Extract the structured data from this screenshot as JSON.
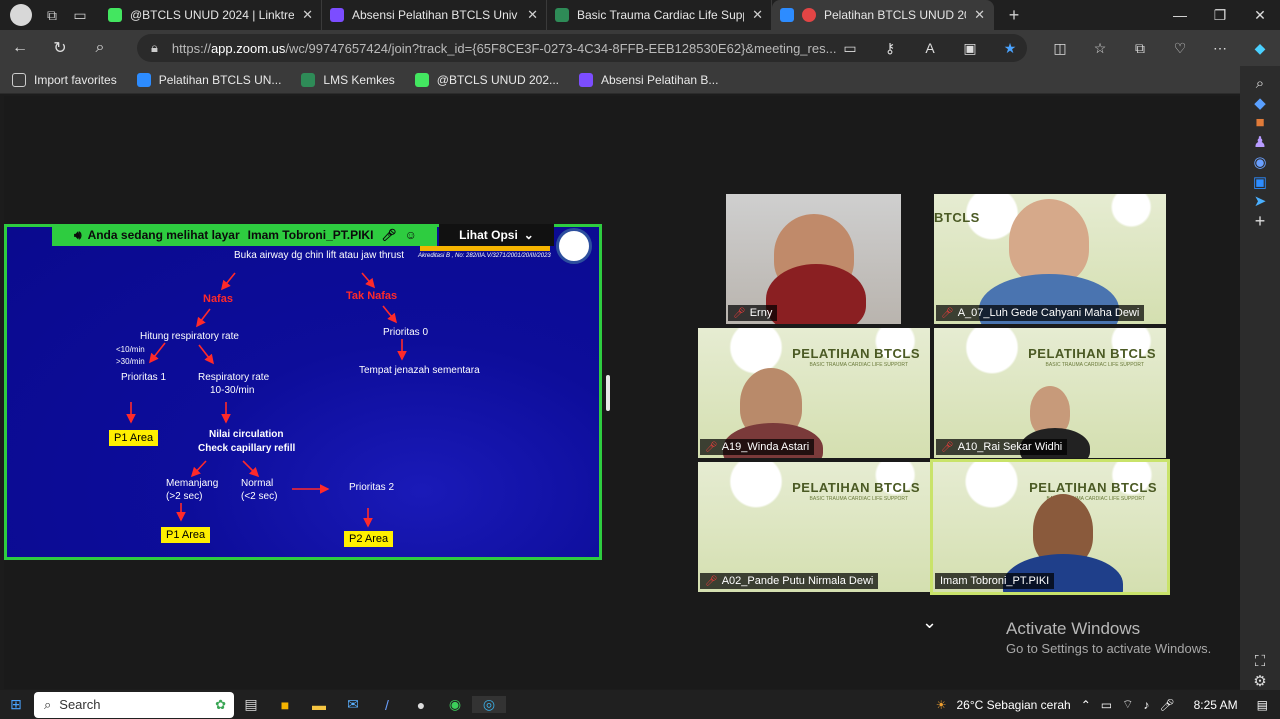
{
  "browser": {
    "tabs": [
      {
        "label": "@BTCLS UNUD 2024 | Linktree",
        "icon": "linktree-icon",
        "color": "#43e660"
      },
      {
        "label": "Absensi Pelatihan BTCLS Univ Ud",
        "icon": "form-icon",
        "color": "#7c4dff"
      },
      {
        "label": "Basic Trauma Cardiac Life Suppor",
        "icon": "lms-icon",
        "color": "#2e8b57"
      },
      {
        "label": "Pelatihan BTCLS UNUD 2024",
        "icon": "zoom-icon",
        "color": "#2d8cff",
        "active": true
      }
    ],
    "url_prefix": "https://",
    "url_host": "app.zoom.us",
    "url_rest": "/wc/99747657424/join?track_id={65F8CE3F-0273-4C34-8FFB-EEB128530E62}&meeting_res...",
    "bookmarks": [
      {
        "label": "Import favorites",
        "icon": "import-icon"
      },
      {
        "label": "Pelatihan BTCLS UN...",
        "icon": "zoom-icon"
      },
      {
        "label": "LMS Kemkes",
        "icon": "lms-icon"
      },
      {
        "label": "@BTCLS UNUD 202...",
        "icon": "linktree-icon"
      },
      {
        "label": "Absensi Pelatihan B...",
        "icon": "form-icon"
      }
    ]
  },
  "share": {
    "banner_prefix": "Anda sedang melihat layar",
    "presenter": "Imam Tobroni_PT.PIKI",
    "options_label": "Lihat Opsi",
    "accreditation": "Akreditasi B , No: 282/IIA.V/3271/2001/20/III/2023"
  },
  "flow": {
    "airway": "Buka airway dg chin lift atau jaw thrust",
    "nafas": "Nafas",
    "tak_nafas": "Tak Nafas",
    "hitung": "Hitung respiratory rate",
    "lt10": "<10/min",
    "gt30": ">30/min",
    "prioritas1": "Prioritas 1",
    "rr": "Respiratory rate",
    "rr_range": "10-30/min",
    "prioritas0": "Prioritas 0",
    "jenazah": "Tempat jenazah sementara",
    "p1a": "P1 Area",
    "nilai": "Nilai circulation",
    "capillary": "Check capillary refill",
    "memanjang": "Memanjang",
    "gt2": "(>2 sec)",
    "normal": "Normal",
    "lt2": "(<2 sec)",
    "prioritas2": "Prioritas 2",
    "p1b": "P1 Area",
    "p2": "P2 Area"
  },
  "participants": [
    {
      "name": "Erny"
    },
    {
      "name": "A_07_Luh Gede Cahyani Maha Dewi"
    },
    {
      "name": "A19_Winda Astari"
    },
    {
      "name": "A10_Rai Sekar Widhi"
    },
    {
      "name": "A02_Pande Putu Nirmala Dewi"
    },
    {
      "name": "Imam Tobroni_PT.PIKI"
    }
  ],
  "slide_bg": {
    "title": "PELATIHAN BTCLS",
    "subtitle": "BASIC TRAUMA CARDIAC LIFE SUPPORT",
    "partial_title": "BTCLS"
  },
  "activation": {
    "line1": "Activate Windows",
    "line2": "Go to Settings to activate Windows."
  },
  "taskbar": {
    "search_label": "Search",
    "weather": "26°C  Sebagian cerah",
    "weather_badge": "1",
    "time": "8:25 AM"
  }
}
